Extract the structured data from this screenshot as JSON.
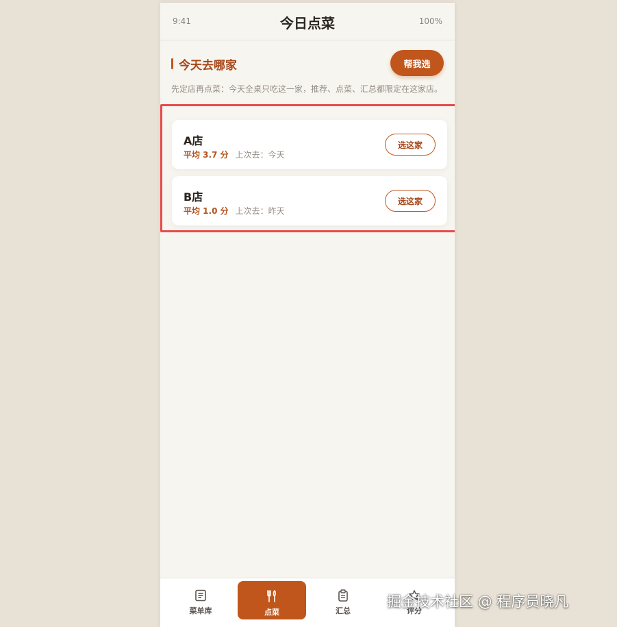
{
  "status_bar": {
    "time": "9:41",
    "title": "今日点菜",
    "battery": "100%"
  },
  "section": {
    "title": "今天去哪家",
    "help_button": "帮我选",
    "hint": "先定店再点菜：今天全桌只吃这一家，推荐、点菜、汇总都限定在这家店。"
  },
  "stores": [
    {
      "name": "A店",
      "avg": "平均 3.7 分",
      "last": "上次去：今天",
      "button": "选这家"
    },
    {
      "name": "B店",
      "avg": "平均 1.0 分",
      "last": "上次去：昨天",
      "button": "选这家"
    }
  ],
  "tabs": [
    {
      "label": "菜单库",
      "icon": "list-icon",
      "active": false
    },
    {
      "label": "点菜",
      "icon": "fork-knife-icon",
      "active": true
    },
    {
      "label": "汇总",
      "icon": "clipboard-icon",
      "active": false
    },
    {
      "label": "评分",
      "icon": "star-icon",
      "active": false
    }
  ],
  "watermark": "掘金技术社区 @ 程序员晓凡",
  "colors": {
    "accent": "#c0561b",
    "highlight": "#e84a4a",
    "background": "#e8e1d6"
  }
}
